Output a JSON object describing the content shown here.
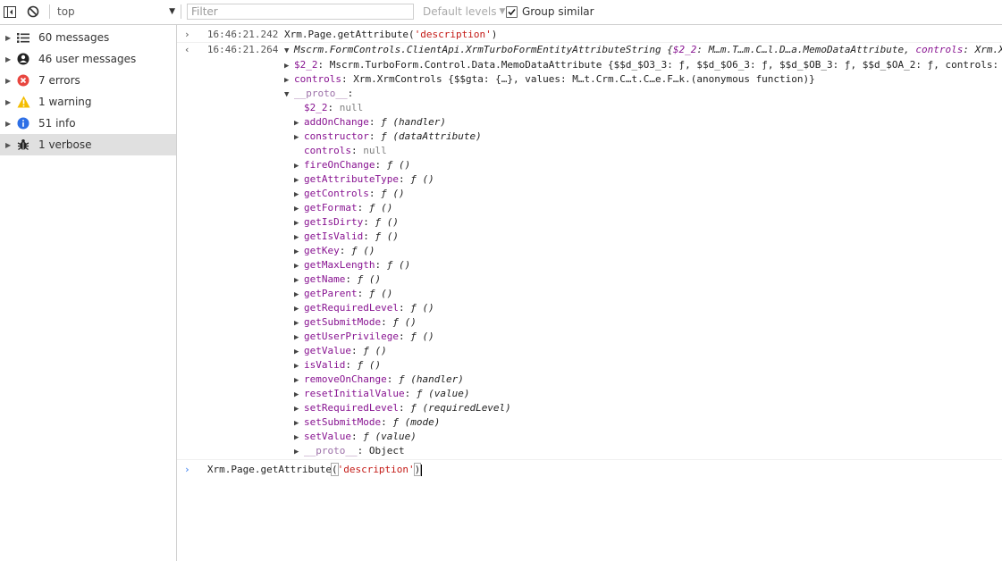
{
  "toolbar": {
    "context": "top",
    "filter_placeholder": "Filter",
    "levels": "Default levels",
    "group_similar": "Group similar"
  },
  "sidebar": {
    "items": [
      {
        "label": "60 messages",
        "icon": "list-icon"
      },
      {
        "label": "46 user messages",
        "icon": "user-icon"
      },
      {
        "label": "7 errors",
        "icon": "error-icon"
      },
      {
        "label": "1 warning",
        "icon": "warning-icon"
      },
      {
        "label": "51 info",
        "icon": "info-icon"
      },
      {
        "label": "1 verbose",
        "icon": "bug-icon"
      }
    ]
  },
  "console": {
    "cmd1": {
      "timestamp": "16:46:21.242",
      "pre": "Xrm.Page.getAttribute(",
      "arg": "'description'",
      "post": ")"
    },
    "result": {
      "timestamp": "16:46:21.264",
      "type_prefix": "Mscrm.FormControls.ClientApi.XrmTurboFormEntityAttributeString {",
      "type_k1": "$2_2",
      "type_v1": ": M…m.T…m.C…l.D…a.MemoDataAttribute, ",
      "type_k2": "controls",
      "type_v2": ": Xrm.Xrm"
    },
    "row_s22": {
      "key": "$2_2",
      "value": ": Mscrm.TurboForm.Control.Data.MemoDataAttribute {$$d_$O3_3: ƒ, $$d_$O6_3: ƒ, $$d_$OB_3: ƒ, $$d_$OA_2: ƒ, controls: X"
    },
    "row_controls": {
      "key": "controls",
      "value": ": Xrm.XrmControls {$$gta: {…}, values: M…t.Crm.C…t.C…e.F…k.(anonymous function)}"
    },
    "proto_label": "__proto__",
    "proto_items": [
      {
        "key": "$2_2",
        "value": "null",
        "expandable": false,
        "kind": "null"
      },
      {
        "key": "addOnChange",
        "value": "ƒ (handler)",
        "expandable": true,
        "kind": "fn"
      },
      {
        "key": "constructor",
        "value": "ƒ (dataAttribute)",
        "expandable": true,
        "kind": "fn"
      },
      {
        "key": "controls",
        "value": "null",
        "expandable": false,
        "kind": "null"
      },
      {
        "key": "fireOnChange",
        "value": "ƒ ()",
        "expandable": true,
        "kind": "fn"
      },
      {
        "key": "getAttributeType",
        "value": "ƒ ()",
        "expandable": true,
        "kind": "fn"
      },
      {
        "key": "getControls",
        "value": "ƒ ()",
        "expandable": true,
        "kind": "fn"
      },
      {
        "key": "getFormat",
        "value": "ƒ ()",
        "expandable": true,
        "kind": "fn"
      },
      {
        "key": "getIsDirty",
        "value": "ƒ ()",
        "expandable": true,
        "kind": "fn"
      },
      {
        "key": "getIsValid",
        "value": "ƒ ()",
        "expandable": true,
        "kind": "fn"
      },
      {
        "key": "getKey",
        "value": "ƒ ()",
        "expandable": true,
        "kind": "fn"
      },
      {
        "key": "getMaxLength",
        "value": "ƒ ()",
        "expandable": true,
        "kind": "fn"
      },
      {
        "key": "getName",
        "value": "ƒ ()",
        "expandable": true,
        "kind": "fn"
      },
      {
        "key": "getParent",
        "value": "ƒ ()",
        "expandable": true,
        "kind": "fn"
      },
      {
        "key": "getRequiredLevel",
        "value": "ƒ ()",
        "expandable": true,
        "kind": "fn"
      },
      {
        "key": "getSubmitMode",
        "value": "ƒ ()",
        "expandable": true,
        "kind": "fn"
      },
      {
        "key": "getUserPrivilege",
        "value": "ƒ ()",
        "expandable": true,
        "kind": "fn"
      },
      {
        "key": "getValue",
        "value": "ƒ ()",
        "expandable": true,
        "kind": "fn"
      },
      {
        "key": "isValid",
        "value": "ƒ ()",
        "expandable": true,
        "kind": "fn"
      },
      {
        "key": "removeOnChange",
        "value": "ƒ (handler)",
        "expandable": true,
        "kind": "fn"
      },
      {
        "key": "resetInitialValue",
        "value": "ƒ (value)",
        "expandable": true,
        "kind": "fn"
      },
      {
        "key": "setRequiredLevel",
        "value": "ƒ (requiredLevel)",
        "expandable": true,
        "kind": "fn"
      },
      {
        "key": "setSubmitMode",
        "value": "ƒ (mode)",
        "expandable": true,
        "kind": "fn"
      },
      {
        "key": "setValue",
        "value": "ƒ (value)",
        "expandable": true,
        "kind": "fn"
      },
      {
        "key": "__proto__",
        "value": "Object",
        "expandable": true,
        "kind": "obj"
      }
    ],
    "input": {
      "pre": "Xrm.Page.getAttribute",
      "lparen": "(",
      "arg": "'description'",
      "rparen": ")"
    }
  },
  "colors": {
    "prompt": "#367cf1",
    "string": "#c41a16",
    "key": "#881391",
    "error": "#e8463f",
    "warning": "#f4bd00",
    "info": "#2d6fe6"
  }
}
